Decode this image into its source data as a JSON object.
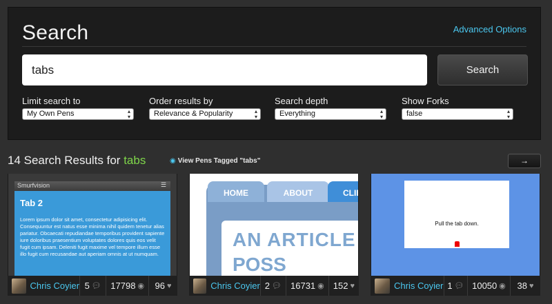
{
  "search": {
    "title": "Search",
    "advanced_label": "Advanced Options",
    "query": "tabs",
    "button_label": "Search"
  },
  "filters": [
    {
      "label": "Limit search to",
      "value": "My Own Pens"
    },
    {
      "label": "Order results by",
      "value": "Relevance & Popularity"
    },
    {
      "label": "Search depth",
      "value": "Everything"
    },
    {
      "label": "Show Forks",
      "value": "false"
    }
  ],
  "results": {
    "count_text": "14 Search Results for",
    "term": "tabs",
    "view_tagged": "View Pens Tagged \"tabs\"",
    "next_label": "→"
  },
  "cards": [
    {
      "preview": {
        "bar_title": "Smurfvision",
        "heading": "Tab 2",
        "body": "Lorem ipsum dolor sit amet, consectetur adipisicing elit. Consequuntur est natus esse minima nihil quidem tenetur alias pariatur. Obcaecati repudiandae temporibus provident sapiente iure doloribus praesentium voluptates dolores quis eos velit fugit cum ipsam. Deleniti fugit maxime vel tempore illum esse illo fugit cum recusandae aut aperiam omnis at ut numquam."
      },
      "author": "Chris Coyier",
      "comments": "5",
      "views": "17798",
      "hearts": "96"
    },
    {
      "preview": {
        "tabs": [
          "HOME",
          "ABOUT",
          "CLIEN"
        ],
        "headline": "AN ARTICLE RIGH",
        "headline2": "POSS"
      },
      "author": "Chris Coyier",
      "comments": "2",
      "views": "16731",
      "hearts": "152"
    },
    {
      "preview": {
        "message": "Pull the tab down."
      },
      "author": "Chris Coyier",
      "comments": "1",
      "views": "10050",
      "hearts": "38"
    }
  ],
  "icons": {
    "comment": "comment-icon",
    "view": "eye-icon",
    "heart": "heart-icon",
    "next": "arrow-right-icon"
  },
  "colors": {
    "accent": "#4bc8f0",
    "term": "#7fd64a"
  }
}
